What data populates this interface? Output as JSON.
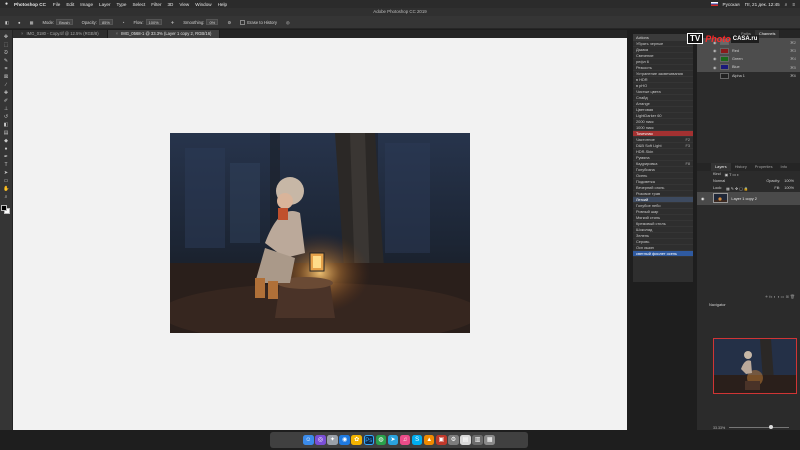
{
  "menubar": {
    "app_name": "Photoshop CC",
    "items": [
      "File",
      "Edit",
      "Image",
      "Layer",
      "Type",
      "Select",
      "Filter",
      "3D",
      "View",
      "Window",
      "Help"
    ],
    "locale": "Русская",
    "clock": "Пт, 21 дек. 12:45"
  },
  "window_title": "Adobe Photoshop CC 2019",
  "options": {
    "mode_label": "Mode:",
    "mode_value": "Brush",
    "opacity_label": "Opacity:",
    "opacity_value": "85%",
    "flow_label": "Flow:",
    "flow_value": "100%",
    "smoothing_label": "Smoothing:",
    "smoothing_value": "0%",
    "erase_history": "Erase to History"
  },
  "tabs": [
    {
      "label": "IMG_0180 - Copy.tif @ 12.5% (RGB/8)"
    },
    {
      "label": "IMG_0568-1 @ 33.3% (Layer 1 copy 2, RGB/16)"
    }
  ],
  "toolbar": {
    "tools": [
      "move",
      "marquee",
      "lasso",
      "quick-select",
      "crop",
      "frame",
      "eyedropper",
      "healing",
      "brush",
      "stamp",
      "history-brush",
      "eraser",
      "gradient",
      "blur",
      "dodge",
      "pen",
      "type",
      "path-select",
      "rectangle",
      "hand",
      "zoom"
    ],
    "fg_color": "#000000",
    "bg_color": "#ffffff"
  },
  "actions_panel": {
    "header": "Actions",
    "items": [
      {
        "label": "Убрать черные",
        "key": ""
      },
      {
        "label": "Дымка",
        "key": ""
      },
      {
        "label": "Свечение",
        "key": ""
      },
      {
        "label": "рефл 6",
        "key": ""
      },
      {
        "label": "Резкость",
        "key": ""
      },
      {
        "label": "Устранение засвечивания",
        "key": ""
      },
      {
        "label": "в HDR",
        "key": ""
      },
      {
        "label": "в рНО",
        "key": ""
      },
      {
        "label": "Чистые цвета",
        "key": ""
      },
      {
        "label": "Слайд",
        "key": ""
      },
      {
        "label": "Arrange",
        "key": ""
      },
      {
        "label": "Цветовая",
        "key": ""
      },
      {
        "label": "LightDarker 60",
        "key": ""
      },
      {
        "label": "2000 пикс",
        "key": ""
      },
      {
        "label": "1000 пикс",
        "key": ""
      },
      {
        "label": "Точечная",
        "key": ""
      },
      {
        "label": "Частотное",
        "key": "F2"
      },
      {
        "label": "D&B Soft Light",
        "key": "F3"
      },
      {
        "label": "HDR-Skin",
        "key": ""
      },
      {
        "label": "Румяна",
        "key": ""
      },
      {
        "label": "Кадрировка",
        "key": "F8"
      },
      {
        "label": "Голубизна",
        "key": ""
      },
      {
        "label": "Осень",
        "key": ""
      },
      {
        "label": "Подсветка",
        "key": ""
      },
      {
        "label": "Вечерний огонь",
        "key": ""
      },
      {
        "label": "Розовое трав",
        "key": ""
      },
      {
        "label": "Легкий",
        "key": ""
      },
      {
        "label": "Голубое небо",
        "key": ""
      },
      {
        "label": "Ровный шар",
        "key": ""
      },
      {
        "label": "Мягкий стиль",
        "key": ""
      },
      {
        "label": "Кремовый стиль",
        "key": ""
      },
      {
        "label": "Шоколад",
        "key": ""
      },
      {
        "label": "Зелень",
        "key": ""
      },
      {
        "label": "Серовь",
        "key": ""
      },
      {
        "label": "Ocn ишин",
        "key": ""
      },
      {
        "label": "светлый фиолет осень",
        "key": ""
      }
    ]
  },
  "channels": {
    "tabs": [
      "Paths",
      "Channels"
    ],
    "rows": [
      {
        "name": "RGB",
        "key": "⌘2",
        "thumb": "#6a6a6a"
      },
      {
        "name": "Red",
        "key": "⌘3",
        "thumb": "#8a1a1a"
      },
      {
        "name": "Green",
        "key": "⌘4",
        "thumb": "#1a6a1a"
      },
      {
        "name": "Blue",
        "key": "⌘5",
        "thumb": "#1a1a7a"
      },
      {
        "name": "Alpha 1",
        "key": "⌘6",
        "thumb": "#222222"
      }
    ]
  },
  "layers": {
    "tabs": [
      "Layers",
      "History",
      "Properties",
      "Info"
    ],
    "kind_label": "Kind",
    "blend_mode": "Normal",
    "opacity_label": "Opacity:",
    "opacity_value": "100%",
    "lock_label": "Lock:",
    "fill_label": "Fill:",
    "fill_value": "100%",
    "layer_name": "Layer 1 copy 2"
  },
  "navigator": {
    "title": "Navigator",
    "zoom": "33.33%"
  },
  "logo": {
    "tv": "TV",
    "photo": "Photo",
    "casa": "CASA.ru"
  },
  "dock_apps": [
    {
      "name": "finder",
      "color": "#3b8bea",
      "glyph": "☺"
    },
    {
      "name": "siri",
      "color": "#7a4fd6",
      "glyph": "◎"
    },
    {
      "name": "launchpad",
      "color": "#9aa0a8",
      "glyph": "✦"
    },
    {
      "name": "safari",
      "color": "#1f7ae0",
      "glyph": "◉"
    },
    {
      "name": "photos",
      "color": "#f4b400",
      "glyph": "✿"
    },
    {
      "name": "photoshop",
      "color": "#0f2a4a",
      "glyph": "Ps"
    },
    {
      "name": "chrome",
      "color": "#2aa14b",
      "glyph": "◍"
    },
    {
      "name": "telegram",
      "color": "#2aa3de",
      "glyph": "➤"
    },
    {
      "name": "itunes",
      "color": "#ea4c89",
      "glyph": "♫"
    },
    {
      "name": "skype",
      "color": "#00aff0",
      "glyph": "S"
    },
    {
      "name": "vlc",
      "color": "#f08a00",
      "glyph": "▲"
    },
    {
      "name": "photo-booth",
      "color": "#c0392b",
      "glyph": "▣"
    },
    {
      "name": "preferences",
      "color": "#7d7d7d",
      "glyph": "⚙"
    },
    {
      "name": "pdf",
      "color": "#d8d8d8",
      "glyph": "▤"
    },
    {
      "name": "archive",
      "color": "#6c6c6c",
      "glyph": "▥"
    },
    {
      "name": "trash",
      "color": "#8a8a8a",
      "glyph": "▦"
    }
  ]
}
